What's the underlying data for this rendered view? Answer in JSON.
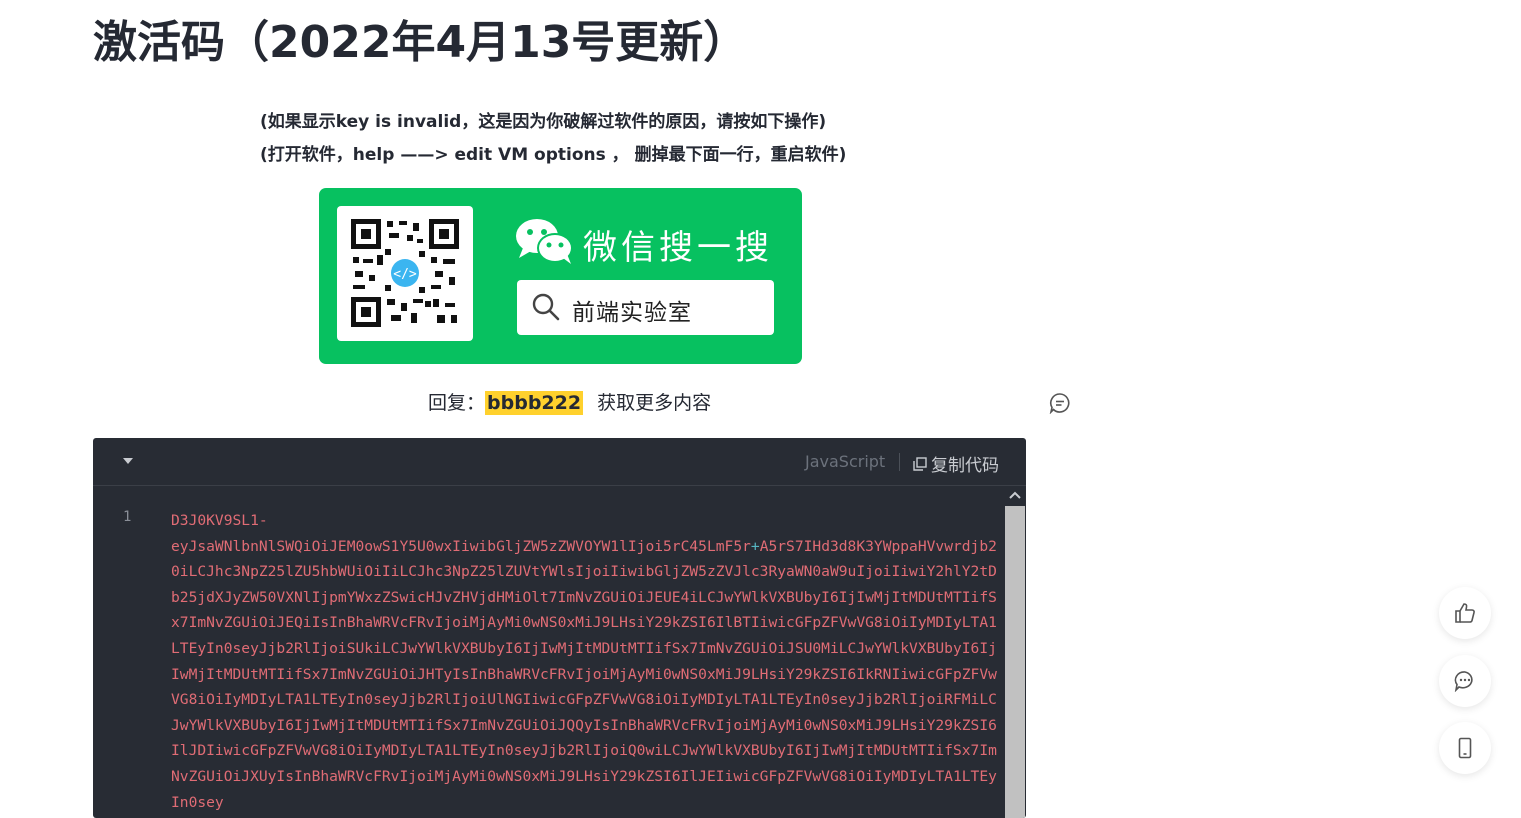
{
  "article": {
    "title": "激活码（2022年4月13号更新）",
    "note_line1": "(如果显示key is invalid，这是因为你破解过软件的原因，请按如下操作)",
    "note_line2": "(打开软件，help ——> edit VM options ， 删掉最下面一行，重启软件)"
  },
  "wechat_card": {
    "title": "微信搜一搜",
    "search_text": "前端实验室",
    "icons": [
      "wechat-logo-icon",
      "search-icon",
      "qr-code"
    ]
  },
  "reply": {
    "prefix": "回复：",
    "keyword": "bbbb222",
    "suffix": "获取更多内容"
  },
  "code_block": {
    "language": "JavaScript",
    "copy_label": "复制代码",
    "line_number": "1",
    "code_line1": "D3J0KV9SL1-",
    "code_line2a": "eyJsaWNlbnNlSWQiOiJEM0owS1Y5U0wxIiwibGljZW5zZWVOYW1lIjoi5rC45LmF5r",
    "code_plus": "+",
    "code_rest": "A5rS7IHd3d8K3YWppaHVvwrdjb20iLCJhc3NpZ25lZU5hbWUiOiIiLCJhc3NpZ25lZUVtYWlsIjoiIiwibGljZW5zZVJlc3RyaWN0aW9uIjoiIiwiY2hlY2tDb25jdXJyZW50VXNlIjpmYWxzZSwicHJvZHVjdHMiOlt7ImNvZGUiOiJEUE4iLCJwYWlkVXBUbyI6IjIwMjItMDUtMTIifSx7ImNvZGUiOiJEQiIsInBhaWRVcFRvIjoiMjAyMi0wNS0xMiJ9LHsiY29kZSI6IlBTIiwicGFpZFVwVG8iOiIyMDIyLTA1LTEyIn0seyJjb2RlIjoiSUkiLCJwYWlkVXBUbyI6IjIwMjItMDUtMTIifSx7ImNvZGUiOiJSU0MiLCJwYWlkVXBUbyI6IjIwMjItMDUtMTIifSx7ImNvZGUiOiJHTyIsInBhaWRVcFRvIjoiMjAyMi0wNS0xMiJ9LHsiY29kZSI6IkRNIiwicGFpZFVwVG8iOiIyMDIyLTA1LTEyIn0seyJjb2RlIjoiUlNGIiwicGFpZFVwVG8iOiIyMDIyLTA1LTEyIn0seyJjb2RlIjoiRFMiLCJwYWlkVXBUbyI6IjIwMjItMDUtMTIifSx7ImNvZGUiOiJQQyIsInBhaWRVcFRvIjoiMjAyMi0wNS0xMiJ9LHsiY29kZSI6IlJDIiwicGFpZFVwVG8iOiIyMDIyLTA1LTEyIn0seyJjb2RlIjoiQ0wiLCJwYWlkVXBUbyI6IjIwMjItMDUtMTIifSx7ImNvZGUiOiJXUyIsInBhaWRVcFRvIjoiMjAyMi0wNS0xMiJ9LHsiY29kZSI6IlJEIiwicGFpZFVwVG8iOiIyMDIyLTA1LTEyIn0sey"
  },
  "side_actions": [
    "thumbs-up-icon",
    "comment-icon",
    "mobile-icon"
  ]
}
